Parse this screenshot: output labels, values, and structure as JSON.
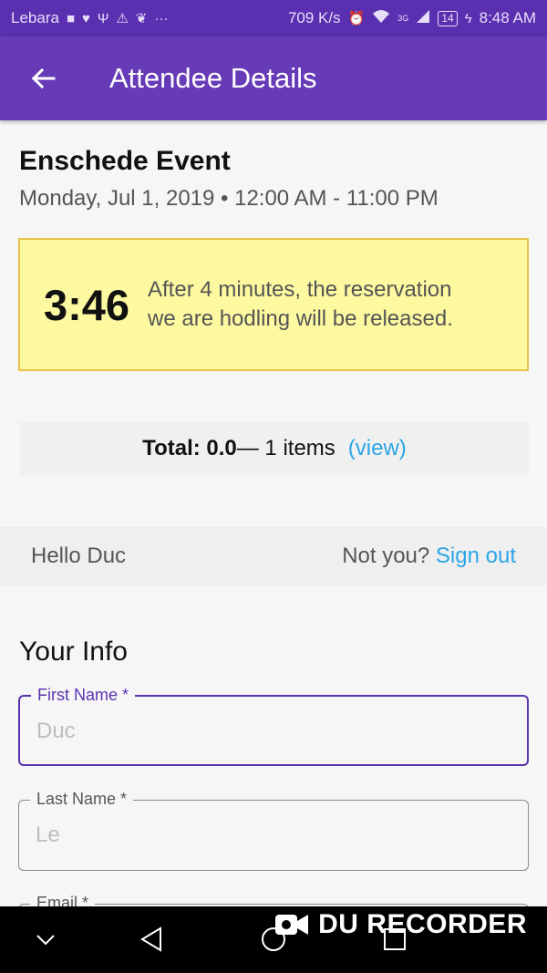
{
  "status_bar": {
    "carrier": "Lebara",
    "speed": "709 K/s",
    "network": "3G",
    "battery": "14",
    "time": "8:48 AM"
  },
  "app_bar": {
    "title": "Attendee Details"
  },
  "event": {
    "name": "Enschede Event",
    "date_time": "Monday, Jul 1, 2019 • 12:00 AM - 11:00 PM"
  },
  "reservation_timer": {
    "time_left": "3:46",
    "message_line1": "After 4 minutes, the reservation",
    "message_line2": "we are hodling will be released."
  },
  "cart_summary": {
    "total_label": "Total: 0.0",
    "items_text": " — 1 items",
    "view_link": "(view)"
  },
  "user_row": {
    "greeting": "Hello Duc",
    "not_you": "Not you? ",
    "sign_out": "Sign out"
  },
  "your_info": {
    "heading": "Your Info",
    "fields": [
      {
        "label": "First Name *",
        "placeholder": "Duc"
      },
      {
        "label": "Last Name *",
        "placeholder": "Le"
      },
      {
        "label": "Email *",
        "placeholder": ""
      }
    ]
  },
  "watermark": "DU RECORDER",
  "colors": {
    "status_bar": "#5a30b0",
    "app_bar": "#673ab7",
    "timer_bg": "#fdf9a1",
    "timer_border": "#e8c24a",
    "link": "#2aa6e6",
    "focus": "#5a34b0"
  }
}
